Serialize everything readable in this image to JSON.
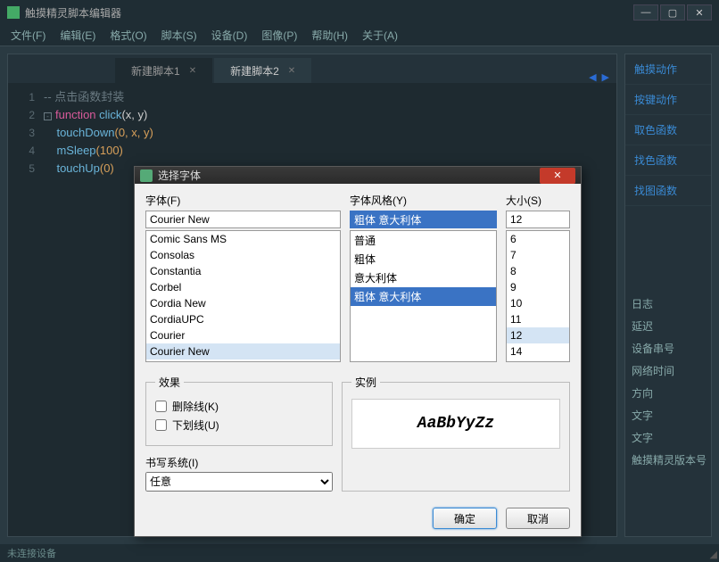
{
  "app": {
    "title": "触摸精灵脚本编辑器",
    "menus": [
      "文件(F)",
      "编辑(E)",
      "格式(O)",
      "脚本(S)",
      "设备(D)",
      "图像(P)",
      "帮助(H)",
      "关于(A)"
    ],
    "status": "未连接设备"
  },
  "tabs": [
    {
      "label": "新建脚本1",
      "active": false
    },
    {
      "label": "新建脚本2",
      "active": true
    }
  ],
  "code": {
    "lines": [
      "1",
      "2",
      "3",
      "4",
      "5"
    ],
    "comment": "-- 点击函数封装",
    "kw_function": "function",
    "fn_click": " click",
    "params": "(x, y)",
    "l3a": "touchDown",
    "l3b": "(0, x, y)",
    "l4a": "mSleep",
    "l4b": "(100)",
    "l5a": "touchUp",
    "l5b": "(0)"
  },
  "side_items": [
    "触摸动作",
    "按键动作",
    "取色函数",
    "找色函数",
    "找图函数"
  ],
  "right_hints": [
    "日志",
    "延迟",
    "设备串号",
    "网络时间",
    "方向",
    "文字",
    "文字",
    "触摸精灵版本号"
  ],
  "dialog": {
    "title": "选择字体",
    "font_label": "字体(F)",
    "font_value": "Courier New",
    "fonts": [
      "Comic Sans MS",
      "Consolas",
      "Constantia",
      "Corbel",
      "Cordia New",
      "CordiaUPC",
      "Courier",
      "Courier New"
    ],
    "style_label": "字体风格(Y)",
    "style_value": "粗体 意大利体",
    "styles": [
      "普通",
      "粗体",
      "意大利体",
      "粗体 意大利体"
    ],
    "size_label": "大小(S)",
    "size_value": "12",
    "sizes": [
      "6",
      "7",
      "8",
      "9",
      "10",
      "11",
      "12",
      "14"
    ],
    "effects_label": "效果",
    "strikeout": "删除线(K)",
    "underline": "下划线(U)",
    "sample_label": "实例",
    "sample_text": "AaBbYyZz",
    "script_label": "书写系统(I)",
    "script_value": "任意",
    "ok": "确定",
    "cancel": "取消"
  }
}
